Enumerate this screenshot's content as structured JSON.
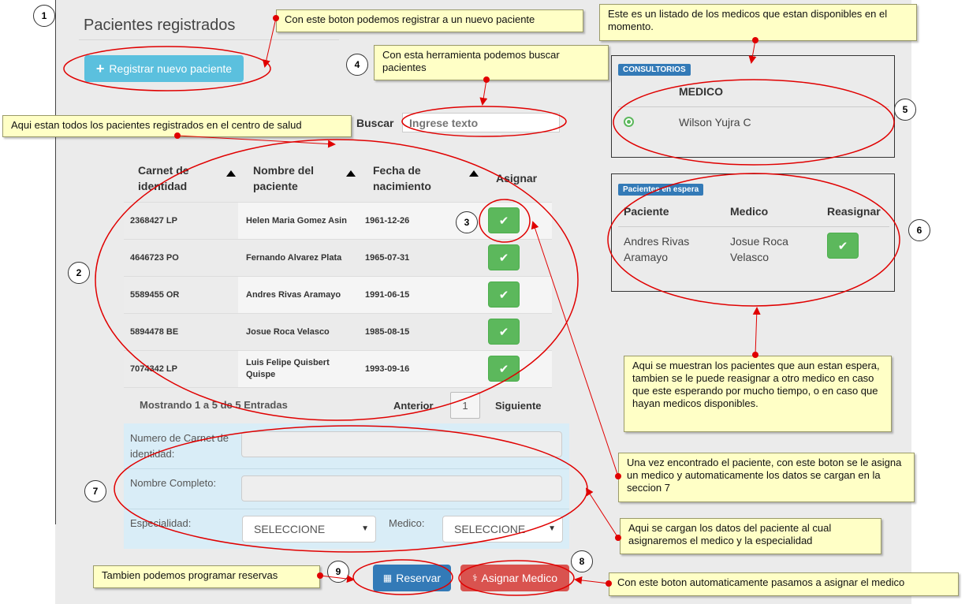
{
  "page": {
    "title": "Pacientes registrados",
    "register_button": "Registrar nuevo paciente",
    "search_label": "Buscar",
    "search_placeholder": "Ingrese texto"
  },
  "table": {
    "headers": [
      "Carnet de identidad",
      "Nombre del paciente",
      "Fecha de nacimiento",
      "Asignar"
    ],
    "rows": [
      {
        "carnet": "2368427 LP",
        "nombre": "Helen Maria Gomez Asin",
        "fecha": "1961-12-26"
      },
      {
        "carnet": "4646723 PO",
        "nombre": "Fernando Alvarez Plata",
        "fecha": "1965-07-31"
      },
      {
        "carnet": "5589455 OR",
        "nombre": "Andres Rivas Aramayo",
        "fecha": "1991-06-15"
      },
      {
        "carnet": "5894478 BE",
        "nombre": "Josue Roca Velasco",
        "fecha": "1985-08-15"
      },
      {
        "carnet": "7074342 LP",
        "nombre": "Luis Felipe Quisbert Quispe",
        "fecha": "1993-09-16"
      }
    ],
    "check_icon": "✔"
  },
  "pager": {
    "info": "Mostrando 1 a 5 de 5 Entradas",
    "prev": "Anterior",
    "page": "1",
    "next": "Siguiente"
  },
  "form": {
    "carnet_label": "Numero de Carnet de identidad:",
    "nombre_label": "Nombre Completo:",
    "especialidad_label": "Especialidad:",
    "especialidad_value": "SELECCIONE",
    "medico_label": "Medico:",
    "medico_value": "SELECCIONE",
    "reservar_button": "Reservar",
    "asignar_button": "Asignar Medico"
  },
  "consultorios": {
    "badge": "CONSULTORIOS",
    "header": "MEDICO",
    "doctor": "Wilson Yujra C",
    "status_color": "#5cb85c"
  },
  "espera": {
    "badge": "Pacientes en espera",
    "headers": [
      "Paciente",
      "Medico",
      "Reasignar"
    ],
    "paciente": "Andres Rivas Aramayo",
    "medico": "Josue Roca Velasco"
  },
  "annotations": {
    "n1": "1",
    "n2": "2",
    "n3": "3",
    "n4": "4",
    "n5": "5",
    "n6": "6",
    "n7": "7",
    "n8": "8",
    "n9": "9",
    "register": "Con este boton podemos registrar a un nuevo paciente",
    "search": "Con esta herramienta podemos buscar pacientes",
    "all_patients": "Aqui estan todos los pacientes registrados en el centro de salud",
    "doctors": "Este es un listado de los medicos que estan disponibles en el momento.",
    "waiting": "Aqui se muestran los pacientes que aun estan espera, tambien se le puede reasignar a otro medico en caso que este esperando por mucho tiempo, o en caso que hayan medicos disponibles.",
    "assign": "Una vez encontrado el paciente, con este boton se le asigna un medico y automaticamente los datos se cargan en la seccion 7",
    "form": "Aqui se cargan los datos del paciente al cual asignaremos el medico y la especialidad",
    "reserve": "Tambien podemos programar reservas",
    "assign_doctor": "Con este boton automaticamente pasamos a asignar el medico"
  },
  "colors": {
    "annotation_red": "#e00000",
    "note_bg": "#ffffc6",
    "success": "#5cb85c",
    "info": "#5bc0de",
    "primary": "#337ab7",
    "danger": "#d9534f"
  }
}
